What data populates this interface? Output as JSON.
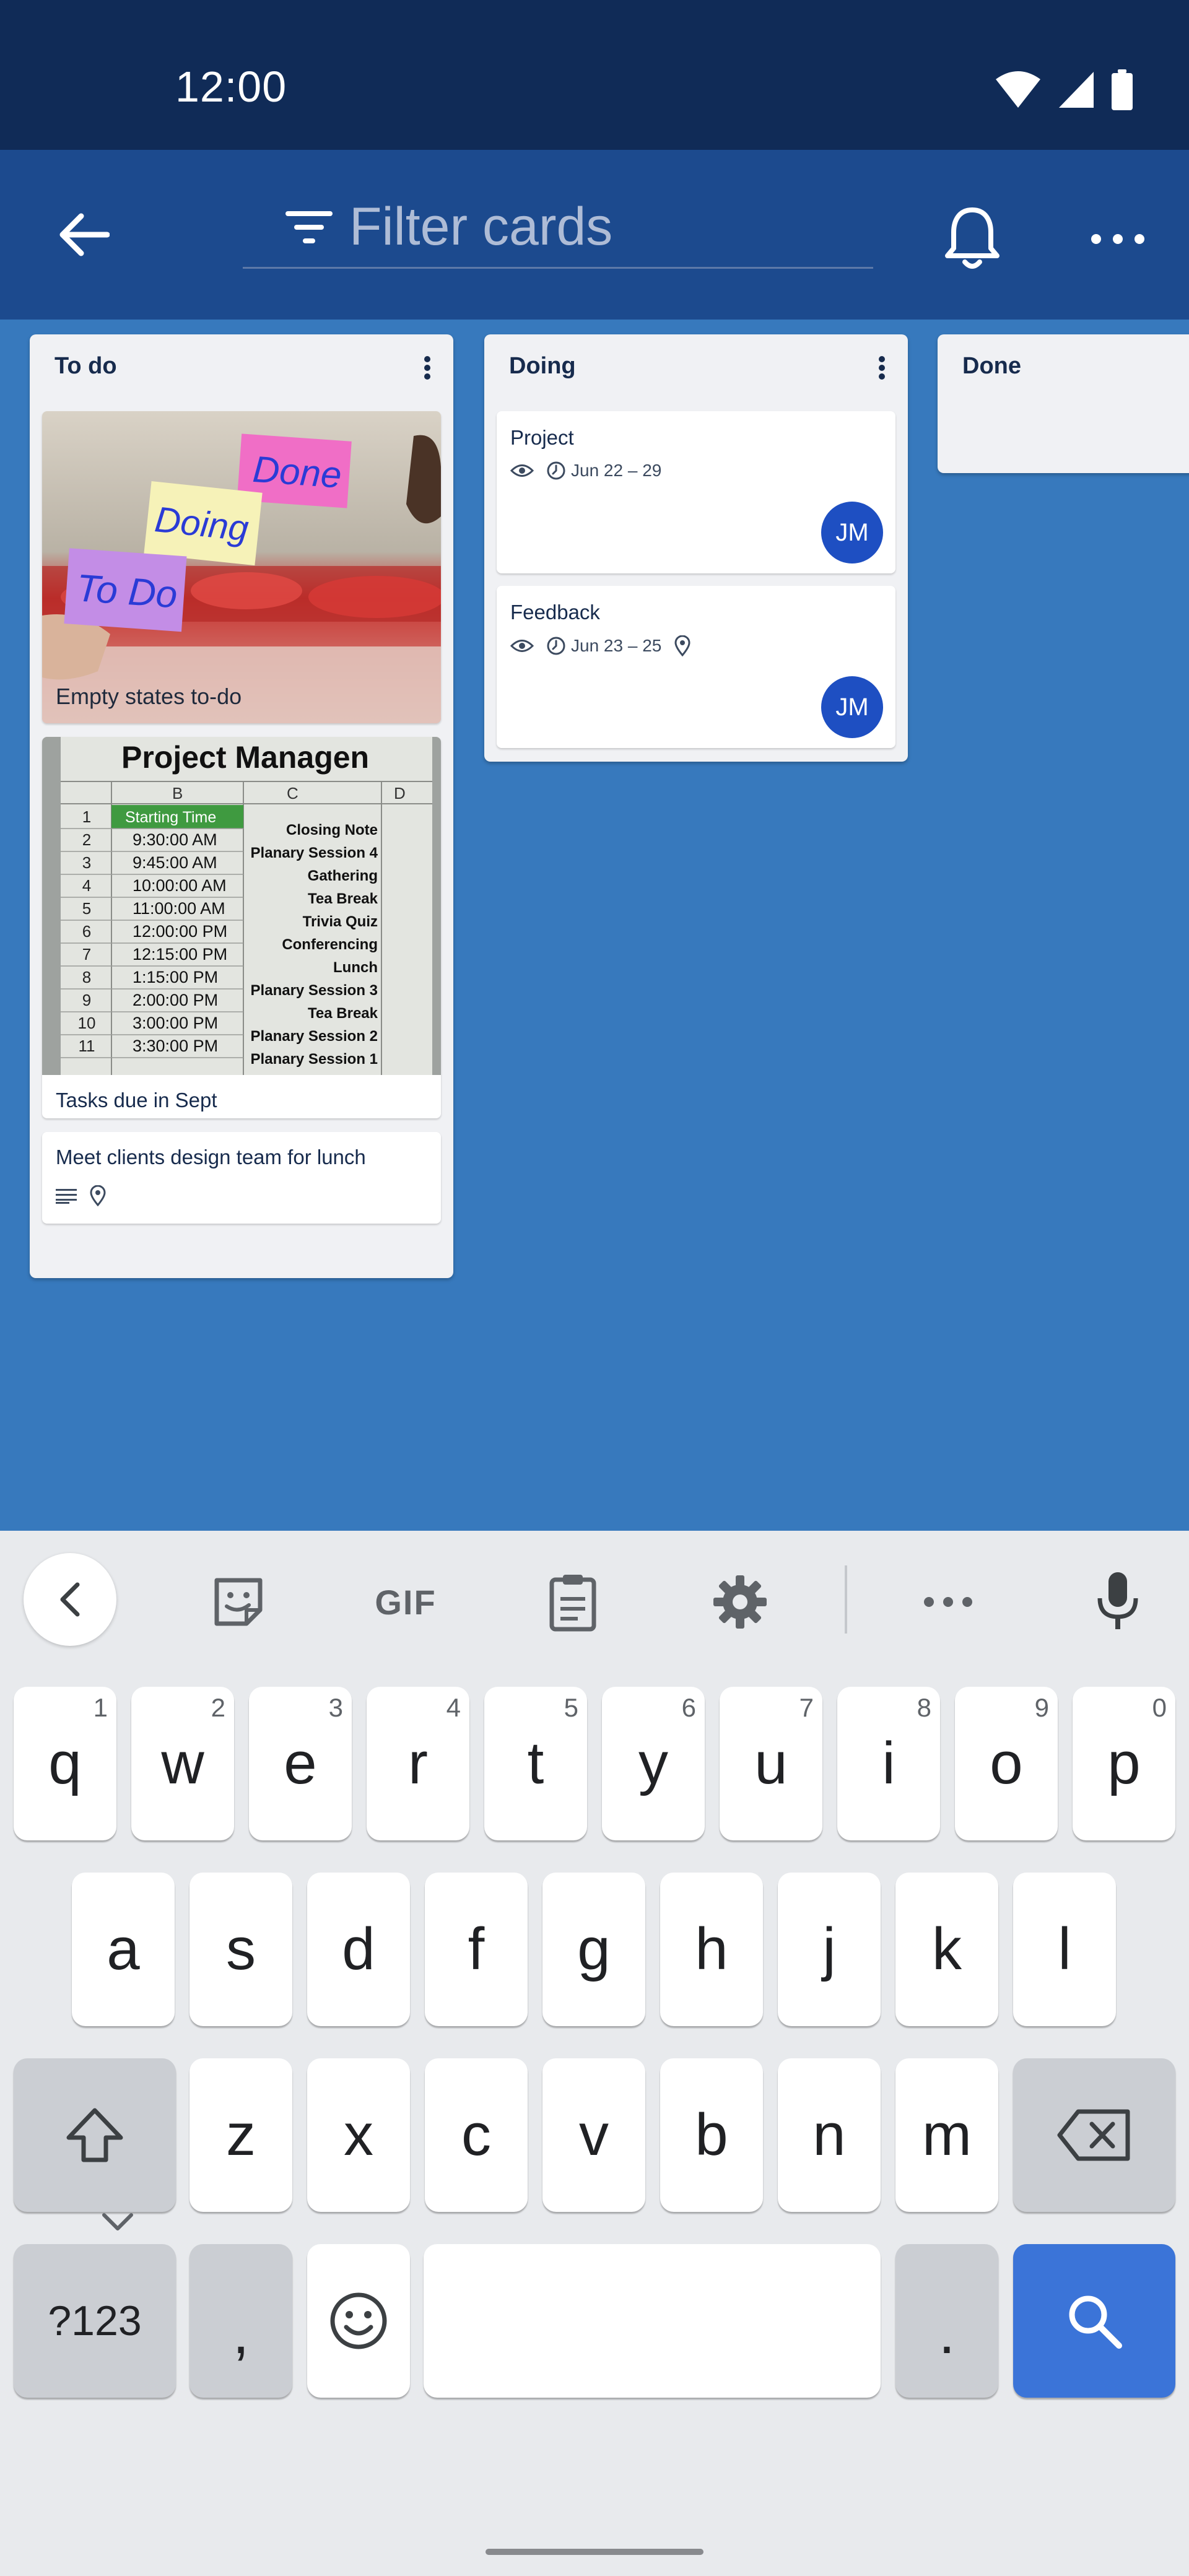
{
  "status": {
    "time": "12:00"
  },
  "appbar": {
    "filter_placeholder": "Filter cards"
  },
  "lists": [
    {
      "name": "To do",
      "cards": [
        {
          "title": "Empty states to-do",
          "cover": "sticky notes photo",
          "notes": [
            "Done",
            "Doing",
            "To Do"
          ]
        },
        {
          "title": "Tasks due in Sept",
          "cover": "spreadsheet photo",
          "attachments": "1",
          "sheet": {
            "title": "Project Managen",
            "cols": [
              "B",
              "C",
              "D"
            ],
            "header": "Starting Time",
            "rows": [
              "1",
              "2",
              "3",
              "4",
              "5",
              "6",
              "7",
              "8",
              "9",
              "10",
              "11"
            ],
            "times": [
              "9:30:00 AM",
              "9:45:00 AM",
              "10:00:00 AM",
              "11:00:00 AM",
              "12:00:00 PM",
              "12:15:00 PM",
              "1:15:00 PM",
              "2:00:00 PM",
              "3:00:00 PM",
              "3:30:00 PM"
            ],
            "events": [
              "Closing Note",
              "Planary Session 4",
              "Gathering",
              "Tea Break",
              "Trivia Quiz",
              "Conferencing",
              "Lunch",
              "Planary Session 3",
              "Tea Break",
              "Planary Session 2",
              "Planary Session 1"
            ]
          }
        },
        {
          "title": "Meet clients design team for lunch"
        }
      ]
    },
    {
      "name": "Doing",
      "cards": [
        {
          "title": "Project",
          "dates": "Jun 22 – 29",
          "member": "JM"
        },
        {
          "title": "Feedback",
          "dates": "Jun 23 – 25",
          "member": "JM"
        }
      ]
    },
    {
      "name": "Done",
      "cards": []
    }
  ],
  "keyboard": {
    "toolbar": {
      "gif": "GIF"
    },
    "row1": [
      {
        "k": "q",
        "h": "1"
      },
      {
        "k": "w",
        "h": "2"
      },
      {
        "k": "e",
        "h": "3"
      },
      {
        "k": "r",
        "h": "4"
      },
      {
        "k": "t",
        "h": "5"
      },
      {
        "k": "y",
        "h": "6"
      },
      {
        "k": "u",
        "h": "7"
      },
      {
        "k": "i",
        "h": "8"
      },
      {
        "k": "o",
        "h": "9"
      },
      {
        "k": "p",
        "h": "0"
      }
    ],
    "row2": [
      "a",
      "s",
      "d",
      "f",
      "g",
      "h",
      "j",
      "k",
      "l"
    ],
    "row3": [
      "z",
      "x",
      "c",
      "v",
      "b",
      "n",
      "m"
    ],
    "symbols_label": "?123",
    "comma": ",",
    "period": "."
  },
  "colors": {
    "status_bar": "#102b57",
    "app_bar": "#1c4a8e",
    "board": "#3779bd",
    "avatar": "#1e4fc2",
    "search_key": "#3b74d8"
  }
}
